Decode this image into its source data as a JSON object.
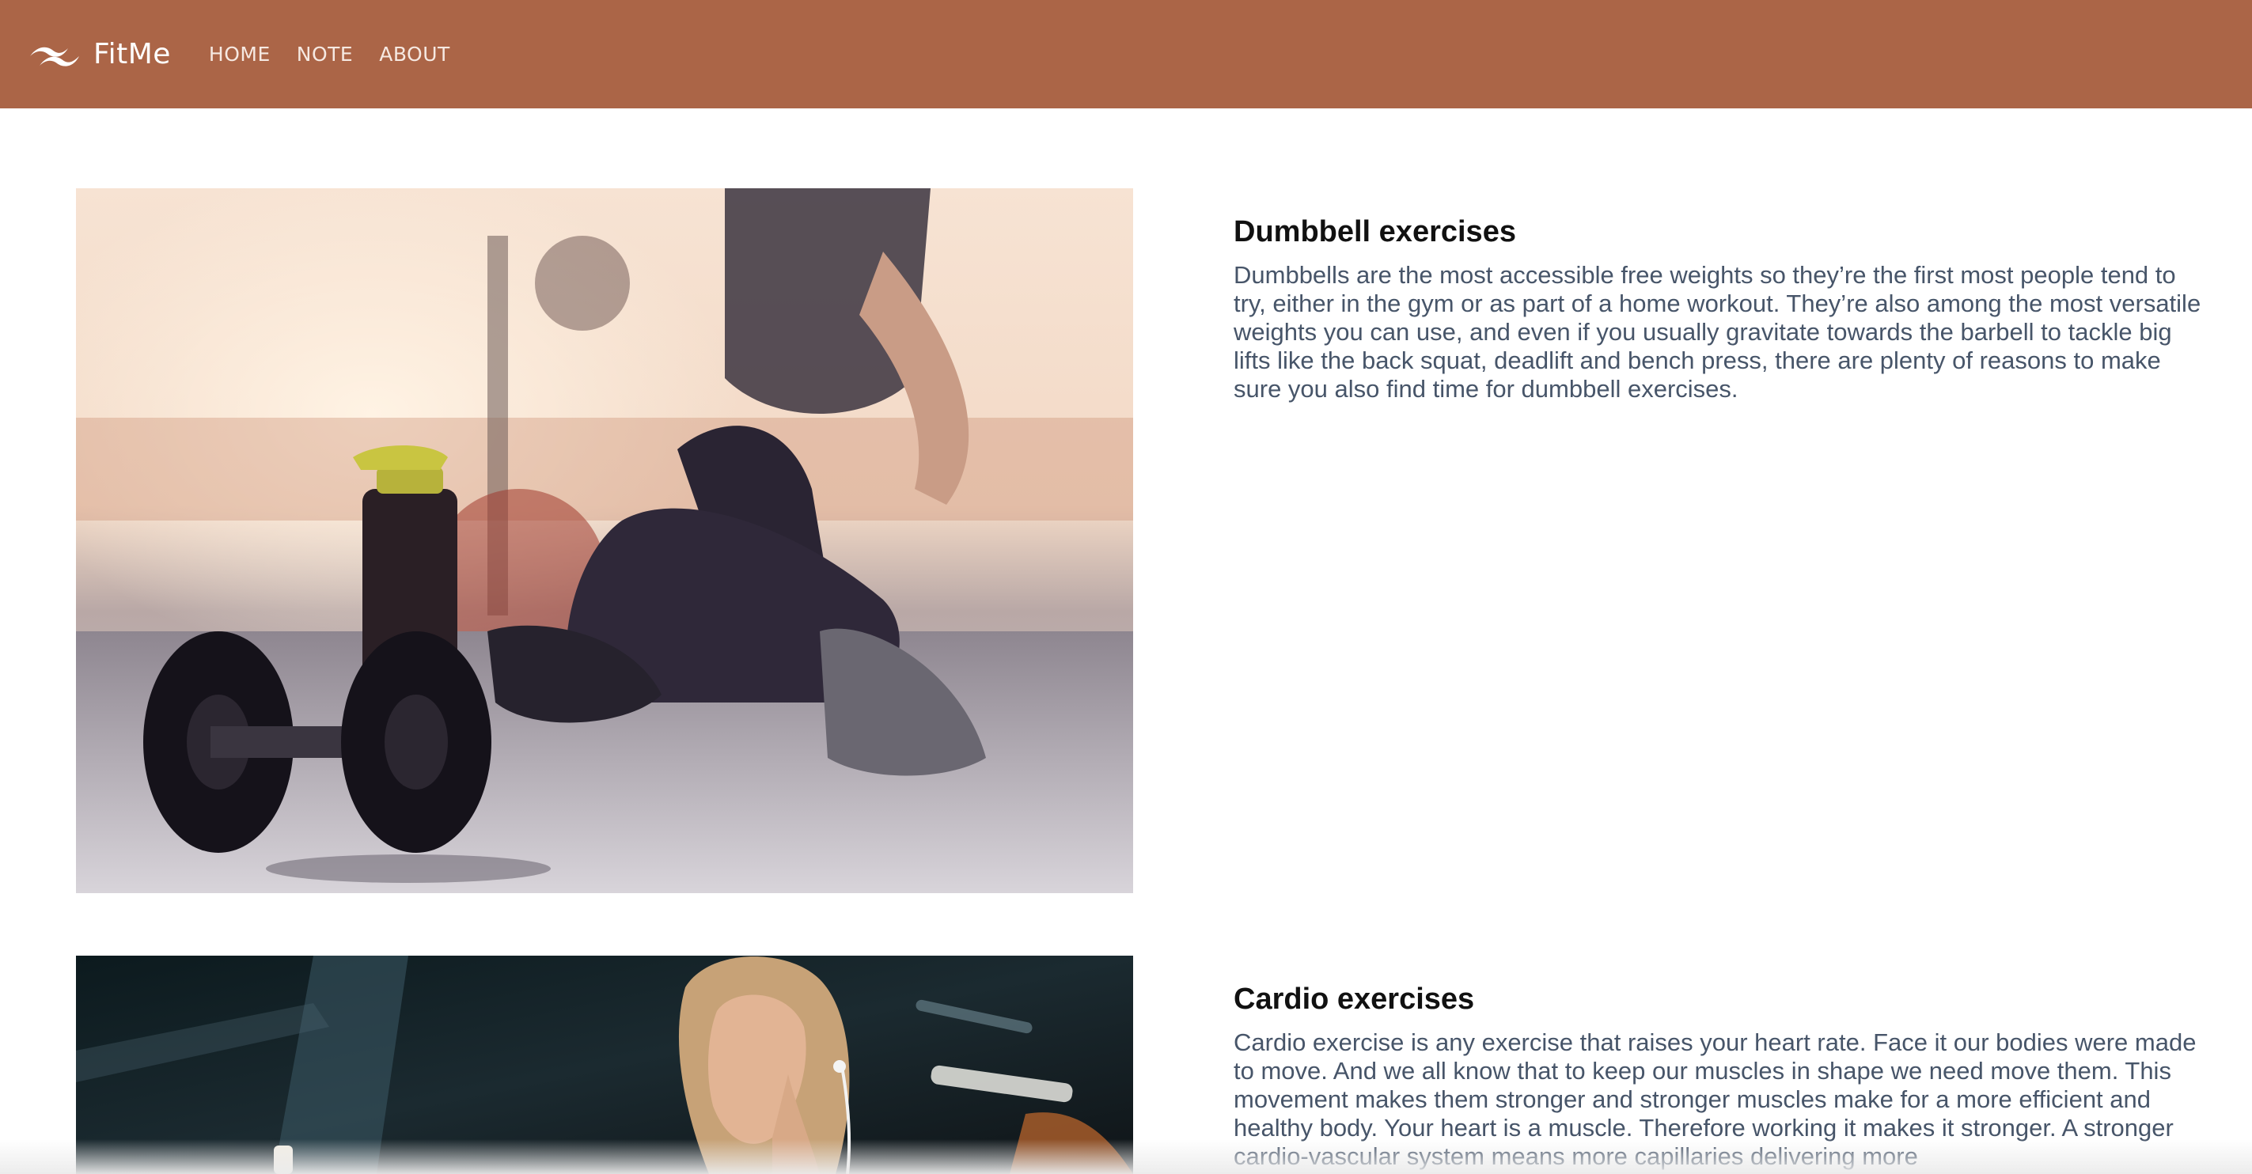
{
  "navbar": {
    "background": "#ab6547",
    "brand": {
      "name": "FitMe",
      "icon": "wave-logo-icon"
    },
    "links": [
      {
        "label": "HOME"
      },
      {
        "label": "NOTE"
      },
      {
        "label": "ABOUT"
      }
    ]
  },
  "cards": [
    {
      "image": "dumbbell-gym-photo",
      "title": "Dumbbell exercises",
      "text": "Dumbbells are the most accessible free weights so they’re the first most people tend to try, either in the gym or as part of a home workout. They’re also among the most versatile weights you can use, and even if you usually gravitate towards the barbell to tackle big lifts like the back squat, deadlift and bench press, there are plenty of reasons to make sure you also find time for dumbbell exercises."
    },
    {
      "image": "cardio-woman-photo",
      "title": "Cardio exercises",
      "text": "Cardio exercise is any exercise that raises your heart rate. Face it our bodies were made to move. And we all know that to keep our muscles in shape we need move them. This movement makes them stronger and stronger muscles make for a more efficient and healthy body. Your heart is a muscle. Therefore working it makes it stronger. A stronger cardio-vascular system means more capillaries delivering more"
    }
  ]
}
